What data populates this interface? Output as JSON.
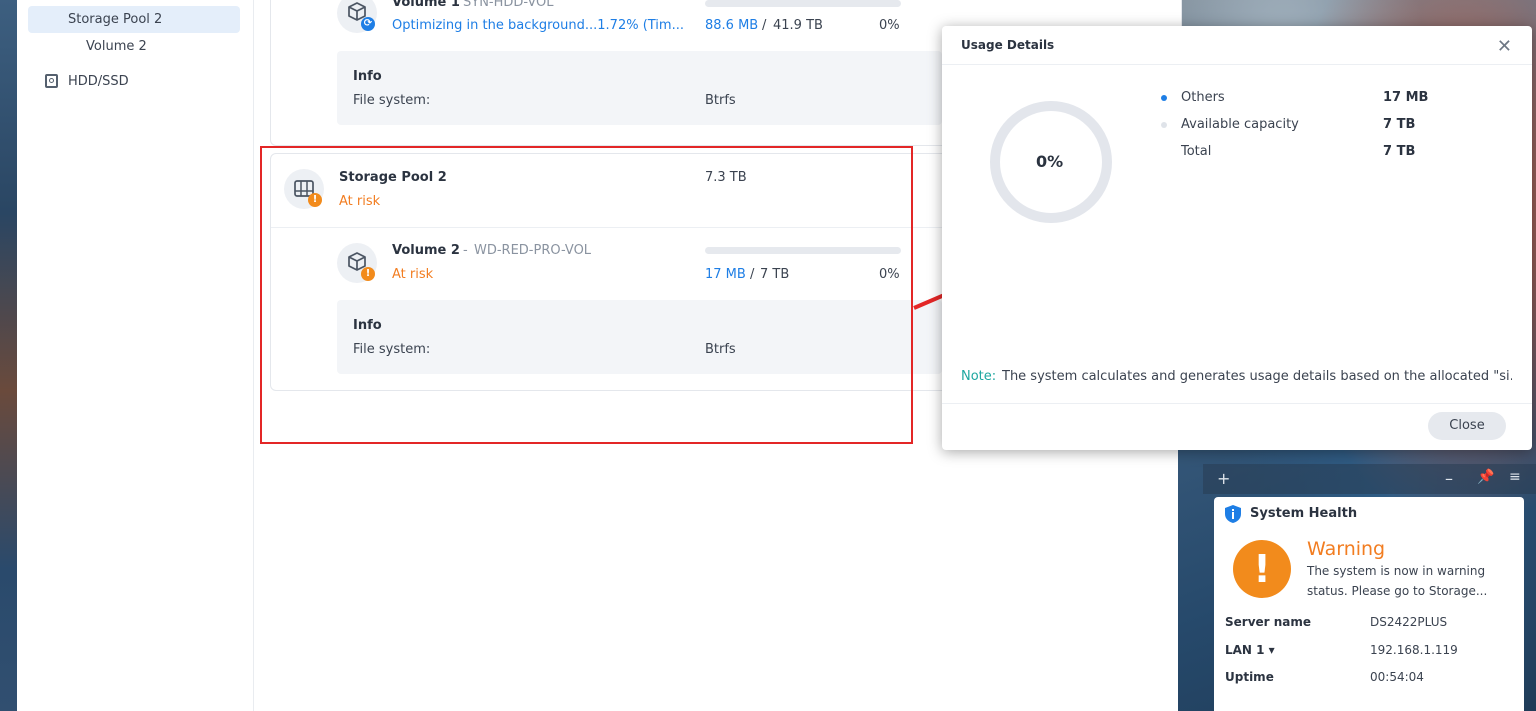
{
  "sidebar": {
    "items": [
      {
        "label": "Storage Pool 2",
        "active": true
      },
      {
        "label": "Volume 2"
      },
      {
        "label": "HDD/SSD",
        "icon": "hdd-icon"
      }
    ]
  },
  "volume1": {
    "title": "Volume 1",
    "subtitle": "SYN-HDD-VOL",
    "status": "Optimizing in the background...1.72% (Tim...",
    "used": "88.6 MB",
    "total": "41.9 TB",
    "percent": "0%",
    "info_title": "Info",
    "fs_label": "File system:",
    "fs_value": "Btrfs"
  },
  "pool2": {
    "title": "Storage Pool 2",
    "status": "At risk",
    "size": "7.3 TB"
  },
  "volume2": {
    "title": "Volume 2",
    "separator": "-",
    "subtitle": "WD-RED-PRO-VOL",
    "status": "At risk",
    "used": "17 MB",
    "slash": "/",
    "total": "7 TB",
    "percent": "0%",
    "info_title": "Info",
    "fs_label": "File system:",
    "fs_value": "Btrfs"
  },
  "modal": {
    "title": "Usage Details",
    "donut_label": "0%",
    "donut_fraction": 0.0,
    "legend": [
      {
        "label": "Others",
        "value": "17 MB",
        "color": "#1e7ee5"
      },
      {
        "label": "Available capacity",
        "value": "7 TB",
        "color": "#dfe3e9"
      },
      {
        "label": "Total",
        "value": "7 TB"
      }
    ],
    "note_label": "Note:",
    "note_text": "The system calculates and generates usage details based on the allocated \"si...",
    "close_button": "Close"
  },
  "widget": {
    "title": "System Health",
    "status_title": "Warning",
    "status_text_1": "The system is now in warning",
    "status_text_2": "status. Please go to Storage...",
    "rows": [
      {
        "label": "Server name",
        "value": "DS2422PLUS"
      },
      {
        "label": "LAN 1 ▾",
        "value": "192.168.1.119"
      },
      {
        "label": "Uptime",
        "value": "00:54:04"
      }
    ]
  },
  "colors": {
    "accent": "#1e7ee5",
    "warning": "#f27d21",
    "highlight": "#e32626"
  }
}
